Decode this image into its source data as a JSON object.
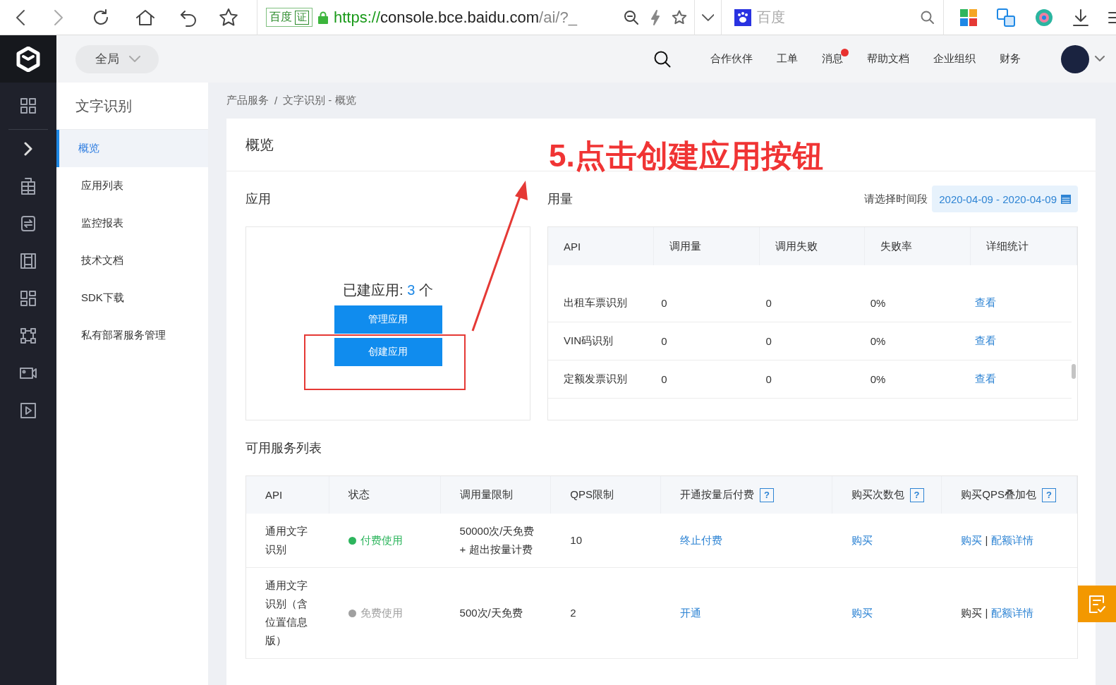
{
  "browser": {
    "badge_text": "百度",
    "badge_cert": "证",
    "url_scheme": "https://",
    "url_host": "console.bce.baidu.com",
    "url_path": "/ai/?_",
    "search_placeholder": "百度"
  },
  "topnav": {
    "scope": "全局",
    "items": [
      {
        "label": "合作伙伴",
        "notification": false
      },
      {
        "label": "工单",
        "notification": false
      },
      {
        "label": "消息",
        "notification": true
      },
      {
        "label": "帮助文档",
        "notification": false
      },
      {
        "label": "企业组织",
        "notification": false
      },
      {
        "label": "财务",
        "notification": false
      }
    ]
  },
  "sidebar": {
    "title": "文字识别",
    "items": [
      {
        "label": "概览",
        "selected": true
      },
      {
        "label": "应用列表",
        "selected": false
      },
      {
        "label": "监控报表",
        "selected": false
      },
      {
        "label": "技术文档",
        "selected": false
      },
      {
        "label": "SDK下载",
        "selected": false
      },
      {
        "label": "私有部署服务管理",
        "selected": false
      }
    ]
  },
  "breadcrumb": {
    "items": [
      "产品服务",
      "文字识别 - 概览"
    ],
    "separator": "/"
  },
  "page_title": "概览",
  "apps": {
    "title": "应用",
    "count_label": "已建应用: ",
    "count": "3",
    "count_unit": "个",
    "buttons": [
      "管理应用",
      "创建应用"
    ]
  },
  "usage": {
    "title": "用量",
    "date_label": "请选择时间段",
    "date_range": "2020-04-09 - 2020-04-09",
    "columns": [
      "API",
      "调用量",
      "调用失败",
      "失败率",
      "详细统计"
    ],
    "rows": [
      {
        "api": "出租车票识别",
        "calls": "0",
        "failures": "0",
        "failure_rate": "0%",
        "action": "查看"
      },
      {
        "api": "VIN码识别",
        "calls": "0",
        "failures": "0",
        "failure_rate": "0%",
        "action": "查看"
      },
      {
        "api": "定额发票识别",
        "calls": "0",
        "failures": "0",
        "failure_rate": "0%",
        "action": "查看"
      }
    ]
  },
  "services": {
    "title": "可用服务列表",
    "columns": [
      {
        "label": "API"
      },
      {
        "label": "状态"
      },
      {
        "label": "调用量限制"
      },
      {
        "label": "QPS限制"
      },
      {
        "label": "开通按量后付费",
        "help": "?"
      },
      {
        "label": "购买次数包",
        "help": "?"
      },
      {
        "label": "购买QPS叠加包",
        "help": "?"
      }
    ],
    "rows": [
      {
        "api": "通用文字识别",
        "status": "付费使用",
        "color": "#2db55d",
        "quota": [
          "50000次/天免费",
          "+ 超出按量计费"
        ],
        "qps": "10",
        "pay": "终止付费",
        "pack": "购买",
        "qps_buy": "购买",
        "qps_buy_link": true,
        "qps_sep": "|",
        "qps_detail": "配额详情"
      },
      {
        "api": "通用文字识别（含位置信息版）",
        "status": "免费使用",
        "color": "#a0a0a0",
        "quota": [
          "500次/天免费"
        ],
        "qps": "2",
        "pay": "开通",
        "pack": "购买",
        "qps_buy": "购买",
        "qps_buy_link": false,
        "qps_sep": "|",
        "qps_detail": "配额详情"
      }
    ]
  },
  "annotation": {
    "text": "5.点击创建应用按钮"
  }
}
